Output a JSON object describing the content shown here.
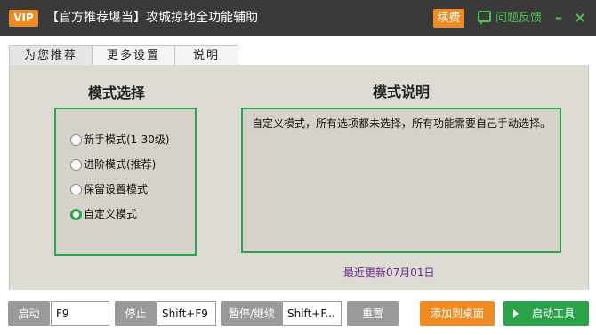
{
  "titlebar": {
    "vip": "VIP",
    "title": "【官方推荐堪当】攻城掠地全功能辅助",
    "renew": "续费",
    "feedback": "问题反馈",
    "minimize": "–",
    "close": "×"
  },
  "tabs": [
    {
      "label": "为您推荐",
      "active": true
    },
    {
      "label": "更多设置",
      "active": false
    },
    {
      "label": "说明",
      "active": false
    }
  ],
  "mode_select": {
    "title": "模式选择",
    "options": [
      {
        "label": "新手模式(1-30级)",
        "checked": false
      },
      {
        "label": "进阶模式(推荐)",
        "checked": false
      },
      {
        "label": "保留设置模式",
        "checked": false
      },
      {
        "label": "自定义模式",
        "checked": true
      }
    ]
  },
  "mode_desc": {
    "title": "模式说明",
    "text": "自定义模式，所有选项都未选择，所有功能需要自己手动选择。"
  },
  "updated": "最近更新07月01日",
  "bottom": {
    "start_label": "启动",
    "start_key": "F9",
    "stop_label": "停止",
    "stop_key": "Shift+F9",
    "pause_label": "暂停/继续",
    "pause_key": "Shift+F...",
    "reset_label": "重置",
    "add_desktop_label": "添加到桌面",
    "launch_label": "启动工具"
  },
  "colors": {
    "titlebar": "#3a3a3a",
    "accent_orange": "#f08a22",
    "accent_green": "#2ba34a",
    "panel_bg": "#dedbd5"
  }
}
